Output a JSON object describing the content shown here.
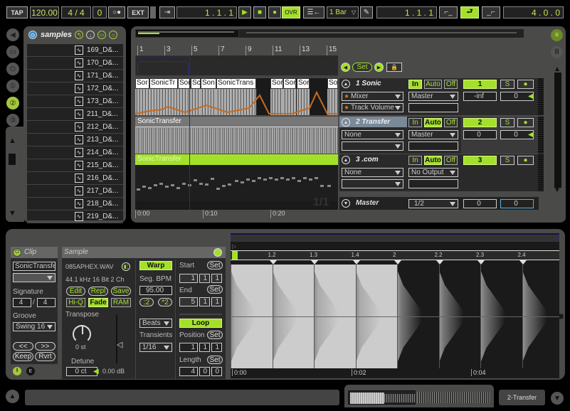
{
  "transport": {
    "tap": "TAP",
    "tempo": "120.00",
    "signature": "4 / 4",
    "groove": "0",
    "metronome": "○●",
    "ext": "EXT",
    "arrangement_position": "1 .   1 .   1",
    "quantize": "1 Bar",
    "overdub": "OVR",
    "loop_start": "1 .   1 .   1",
    "loop_length": "4 .   0 .   0"
  },
  "browser": {
    "title": "samples",
    "files": [
      "169_D&...",
      "170_D&...",
      "171_D&...",
      "172_D&...",
      "173_D&...",
      "211_D&...",
      "212_D&...",
      "213_D&...",
      "214_D&...",
      "215_D&...",
      "216_D&...",
      "217_D&...",
      "218_D&...",
      "219_D&..."
    ]
  },
  "arrangement": {
    "bar_ruler": [
      "1",
      "3",
      "5",
      "7",
      "9",
      "11",
      "13",
      "15"
    ],
    "time_ruler": [
      "0:00",
      "0:10",
      "0:20"
    ],
    "zoom_label": "1/1",
    "track1_clips": [
      "Sor",
      "SonicTr",
      "Sor",
      "Sc",
      "Son",
      "SonicTrans"
    ],
    "track1_clips_right": [
      "Sor",
      "Sor",
      "Sor",
      "Sor"
    ],
    "track2_clip": "SonicTransfer",
    "track3_clip": "SonicTransfer"
  },
  "mixer": {
    "set_label": "Set",
    "tracks": [
      {
        "name": "1 Sonic",
        "in": "In",
        "auto": "Auto",
        "off": "Off",
        "number": "1",
        "solo": "S",
        "device": "Mixer",
        "param": "Track Volume",
        "output": "Master",
        "volume": "-inf",
        "pan": "0"
      },
      {
        "name": "2 Transfer",
        "in": "In",
        "auto": "Auto",
        "off": "Off",
        "number": "2",
        "solo": "S",
        "device": "None",
        "param": "",
        "output": "Master",
        "volume": "0",
        "pan": "0"
      },
      {
        "name": "3 .com",
        "in": "In",
        "auto": "Auto",
        "off": "Off",
        "number": "3",
        "solo": "S",
        "device": "None",
        "param": "",
        "output": "No Output",
        "volume": "",
        "pan": ""
      }
    ],
    "master": {
      "name": "Master",
      "output": "1/2",
      "volume": "0",
      "pan": "0"
    }
  },
  "clip": {
    "title": "Clip",
    "name": "SonicTransfe",
    "signature_label": "Signature",
    "sig_num": "4",
    "sig_den": "4",
    "groove_label": "Groove",
    "groove": "Swing 16",
    "nudge_back": "<<",
    "nudge_fwd": ">>",
    "keep": "Keep",
    "rvrt": "Rvrt"
  },
  "sample": {
    "title": "Sample",
    "file": "085APHEX.WAV",
    "info": "44.1 kHz 16 Bit 2 Ch",
    "edit": "Edit",
    "repl": "Repl",
    "save": "Save",
    "hiq": "Hi-Q",
    "fade": "Fade",
    "ram": "RAM",
    "transpose_label": "Transpose",
    "transpose": "0 st",
    "detune_label": "Detune",
    "detune": "0 ct",
    "gain": "0.00 dB",
    "warp": "Warp",
    "seg_bpm_label": "Seg. BPM",
    "seg_bpm": "95.00",
    "half": ":2",
    "double": "*2",
    "warp_mode": "Beats",
    "transients_label": "Transients",
    "transients": "1/16",
    "start_label": "Start",
    "start": [
      "1",
      "1",
      "1"
    ],
    "end_label": "End",
    "end": [
      "5",
      "1",
      "1"
    ],
    "set": "Set",
    "loop": "Loop",
    "position_label": "Position",
    "position": [
      "1",
      "1",
      "1"
    ],
    "length_label": "Length",
    "length": [
      "4",
      "0",
      "0"
    ]
  },
  "sample_display": {
    "beat_markers": [
      "1",
      "1.2",
      "1.3",
      "1.4",
      "2",
      "2.2",
      "2.3",
      "2.4"
    ],
    "time_markers": [
      "0:00",
      "0:02",
      "0:04"
    ]
  },
  "status": {
    "selected_track": "2-Transfer"
  }
}
